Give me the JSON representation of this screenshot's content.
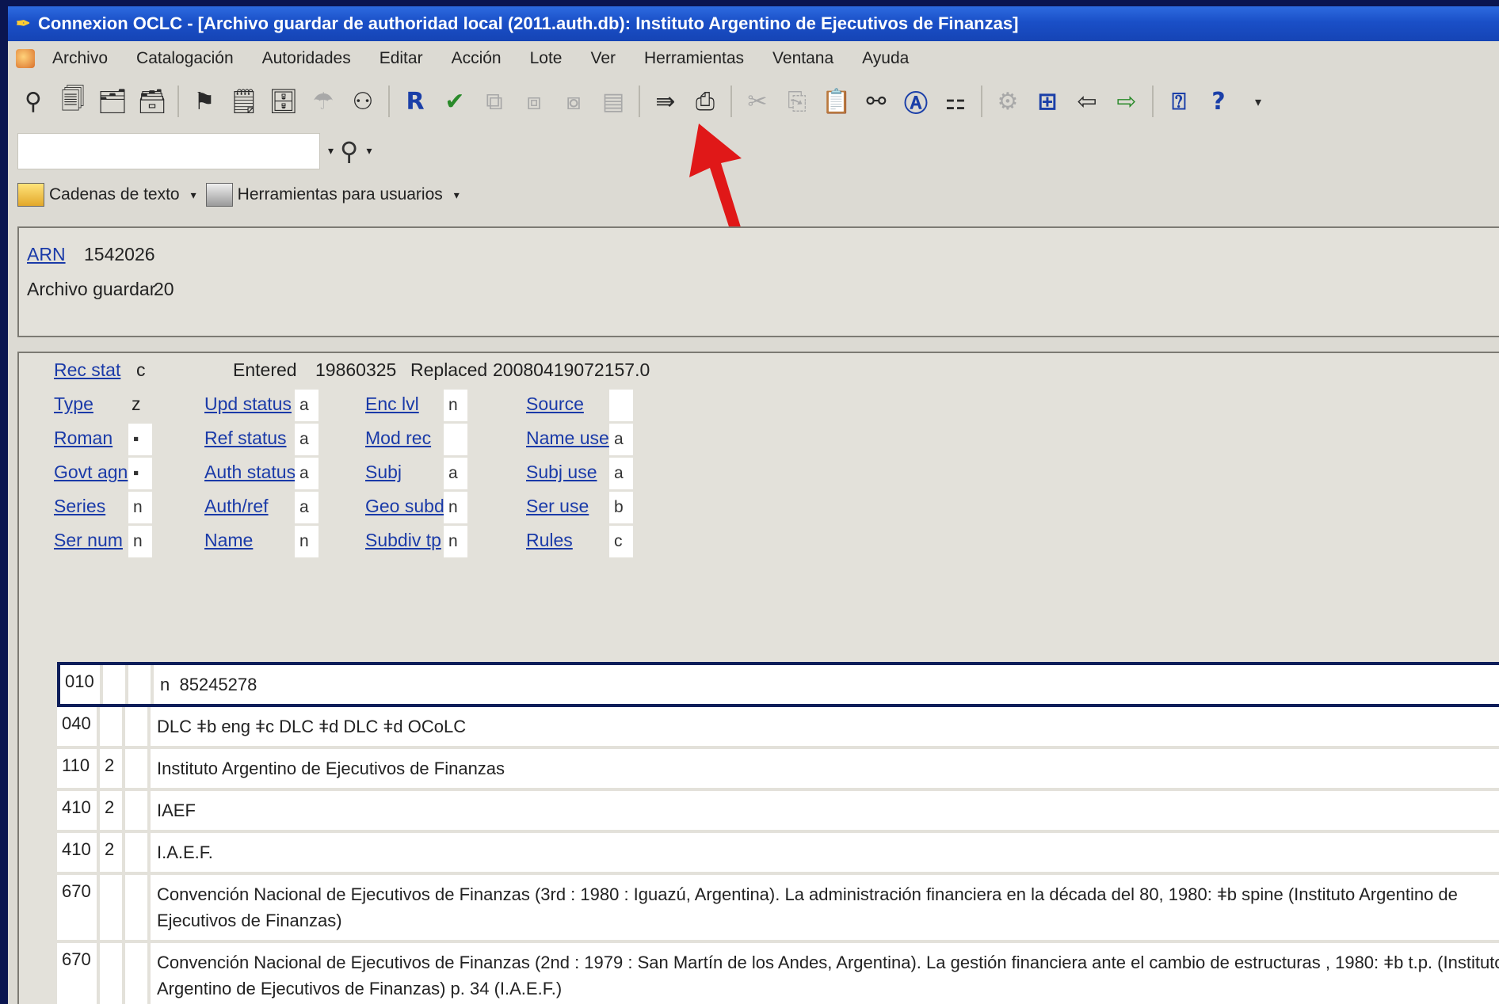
{
  "window": {
    "title": "Connexion OCLC - [Archivo guardar de authoridad local (2011.auth.db): Instituto Argentino de Ejecutivos de Finanzas]"
  },
  "menubar": {
    "items": [
      "Archivo",
      "Catalogación",
      "Autoridades",
      "Editar",
      "Acción",
      "Lote",
      "Ver",
      "Herramientas",
      "Ventana",
      "Ayuda"
    ]
  },
  "toolbar": {
    "r_label": "R",
    "help_label": "?"
  },
  "tools": {
    "text_strings_label": "Cadenas de texto",
    "user_tools_label": "Herramientas para usuarios"
  },
  "record": {
    "arn_label": "ARN",
    "arn_value": "1542026",
    "save_file_label": "Archivo guardar",
    "save_file_value": "20"
  },
  "fixed_fields": {
    "rec_stat": {
      "label": "Rec stat",
      "value": "c"
    },
    "entered": {
      "label": "Entered",
      "value": "19860325"
    },
    "replaced": {
      "label": "Replaced",
      "value": "20080419072157.0"
    },
    "type": {
      "label": "Type",
      "value": "z"
    },
    "upd_status": {
      "label": "Upd status",
      "value": "a"
    },
    "enc_lvl": {
      "label": "Enc lvl",
      "value": "n"
    },
    "source": {
      "label": "Source",
      "value": ""
    },
    "roman": {
      "label": "Roman",
      "value": "▪"
    },
    "ref_status": {
      "label": "Ref status",
      "value": "a"
    },
    "mod_rec": {
      "label": "Mod rec",
      "value": ""
    },
    "name_use": {
      "label": "Name use",
      "value": "a"
    },
    "govt_agn": {
      "label": "Govt agn",
      "value": "▪"
    },
    "auth_status": {
      "label": "Auth status",
      "value": "a"
    },
    "subj": {
      "label": "Subj",
      "value": "a"
    },
    "subj_use": {
      "label": "Subj use",
      "value": "a"
    },
    "series": {
      "label": "Series",
      "value": "n"
    },
    "auth_ref": {
      "label": "Auth/ref",
      "value": "a"
    },
    "geo_subd": {
      "label": "Geo subd",
      "value": "n"
    },
    "ser_use": {
      "label": "Ser use",
      "value": "b"
    },
    "ser_num": {
      "label": "Ser num",
      "value": "n"
    },
    "name": {
      "label": "Name",
      "value": "n"
    },
    "subdiv_tp": {
      "label": "Subdiv tp",
      "value": "n"
    },
    "rules": {
      "label": "Rules",
      "value": "c"
    }
  },
  "variable_fields": [
    {
      "tag": "010",
      "ind1": "",
      "ind2": "",
      "data": "n  85245278"
    },
    {
      "tag": "040",
      "ind1": "",
      "ind2": "",
      "data": "DLC ǂb eng ǂc DLC ǂd DLC ǂd OCoLC"
    },
    {
      "tag": "110",
      "ind1": "2",
      "ind2": "",
      "data": "Instituto Argentino de Ejecutivos de Finanzas"
    },
    {
      "tag": "410",
      "ind1": "2",
      "ind2": "",
      "data": "IAEF"
    },
    {
      "tag": "410",
      "ind1": "2",
      "ind2": "",
      "data": "I.A.E.F."
    },
    {
      "tag": "670",
      "ind1": "",
      "ind2": "",
      "data": "Convención Nacional de Ejecutivos de Finanzas (3rd : 1980 : Iguazú, Argentina). La administración financiera en la década del 80, 1980: ǂb spine (Instituto Argentino de Ejecutivos de Finanzas)"
    },
    {
      "tag": "670",
      "ind1": "",
      "ind2": "",
      "data": "Convención Nacional de Ejecutivos de Finanzas (2nd : 1979 : San Martín de los Andes, Argentina). La gestión financiera ante el cambio de estructuras , 1980: ǂb t.p. (Instituto Argentino de Ejecutivos de Finanzas) p. 34 (I.A.E.F.)"
    }
  ],
  "colors": {
    "titlebar": "#1a4fc7",
    "link": "#1a3aa8",
    "active_row_border": "#0d1e5a",
    "arrow": "#e01818"
  }
}
